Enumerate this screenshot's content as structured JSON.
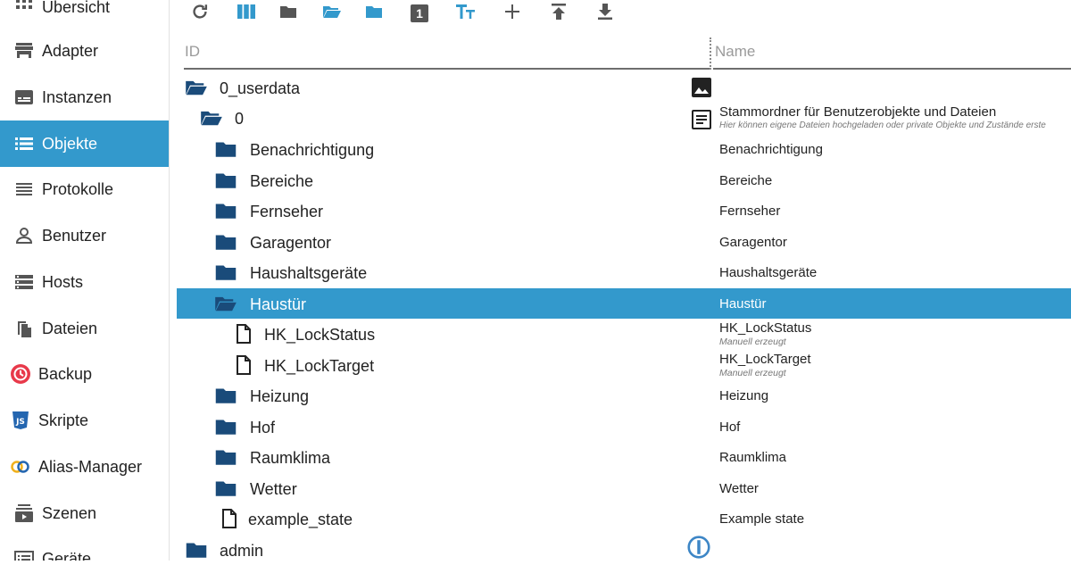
{
  "sidebar": {
    "items": [
      {
        "label": "Übersicht",
        "icon": "grid-icon"
      },
      {
        "label": "Adapter",
        "icon": "store-icon"
      },
      {
        "label": "Instanzen",
        "icon": "instances-icon"
      },
      {
        "label": "Objekte",
        "icon": "list-icon",
        "active": true
      },
      {
        "label": "Protokolle",
        "icon": "log-lines-icon"
      },
      {
        "label": "Benutzer",
        "icon": "user-icon"
      },
      {
        "label": "Hosts",
        "icon": "server-icon"
      },
      {
        "label": "Dateien",
        "icon": "files-icon"
      },
      {
        "label": "Backup",
        "icon": "backup-icon"
      },
      {
        "label": "Skripte",
        "icon": "js-icon"
      },
      {
        "label": "Alias-Manager",
        "icon": "alias-rings-icon"
      },
      {
        "label": "Szenen",
        "icon": "scenes-icon"
      },
      {
        "label": "Geräte",
        "icon": "devices-icon"
      }
    ]
  },
  "toolbar": {
    "buttons": [
      {
        "name": "refresh-icon"
      },
      {
        "name": "columns-icon"
      },
      {
        "name": "folder-closed-icon"
      },
      {
        "name": "folder-open-icon"
      },
      {
        "name": "folder-blue-icon"
      },
      {
        "name": "count-badge-icon",
        "text": "1"
      },
      {
        "name": "text-size-icon"
      },
      {
        "name": "plus-icon"
      },
      {
        "name": "upload-icon"
      },
      {
        "name": "download-icon"
      }
    ]
  },
  "table": {
    "col_id": "ID",
    "col_name": "Name",
    "rows": [
      {
        "id": "0_userdata",
        "name": ""
      },
      {
        "id": "0",
        "name": "Stammordner für Benutzerobjekte und Dateien",
        "sub": "Hier können eigene Dateien hochgeladen oder private Objekte und Zustände erste"
      },
      {
        "id": "Benachrichtigung",
        "name": "Benachrichtigung"
      },
      {
        "id": "Bereiche",
        "name": "Bereiche"
      },
      {
        "id": "Fernseher",
        "name": "Fernseher"
      },
      {
        "id": "Garagentor",
        "name": "Garagentor"
      },
      {
        "id": "Haushaltsgeräte",
        "name": "Haushaltsgeräte"
      },
      {
        "id": "Haustür",
        "name": "Haustür"
      },
      {
        "id": "HK_LockStatus",
        "name": "HK_LockStatus",
        "sub": "Manuell erzeugt"
      },
      {
        "id": "HK_LockTarget",
        "name": "HK_LockTarget",
        "sub": "Manuell erzeugt"
      },
      {
        "id": "Heizung",
        "name": "Heizung"
      },
      {
        "id": "Hof",
        "name": "Hof"
      },
      {
        "id": "Raumklima",
        "name": "Raumklima"
      },
      {
        "id": "Wetter",
        "name": "Wetter"
      },
      {
        "id": "example_state",
        "name": "Example state"
      },
      {
        "id": "admin",
        "name": ""
      }
    ]
  },
  "colors": {
    "accent": "#3399cc",
    "folder": "#1a4b7a",
    "selected_text": "#ffffff"
  }
}
